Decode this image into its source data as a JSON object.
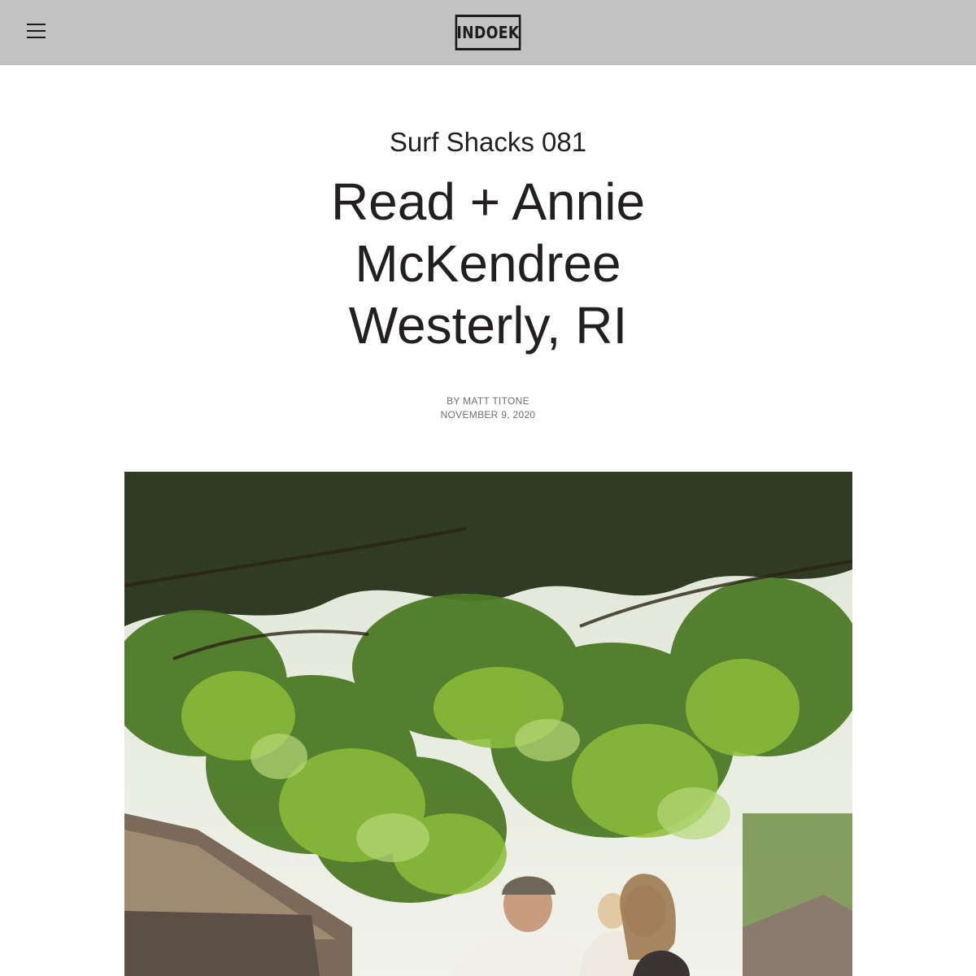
{
  "header": {
    "menu_icon": "hamburger-menu-icon",
    "logo_text": "INDOEK",
    "background": "#c2c2c2"
  },
  "article": {
    "series": "Surf Shacks 081",
    "title_lines": [
      "Read + Annie",
      "McKendree",
      "Westerly, RI"
    ],
    "byline": "BY MATT TITONE",
    "date": "NOVEMBER 9, 2020"
  },
  "hero_image": {
    "subject": "couple-with-child-under-tree-photo"
  }
}
